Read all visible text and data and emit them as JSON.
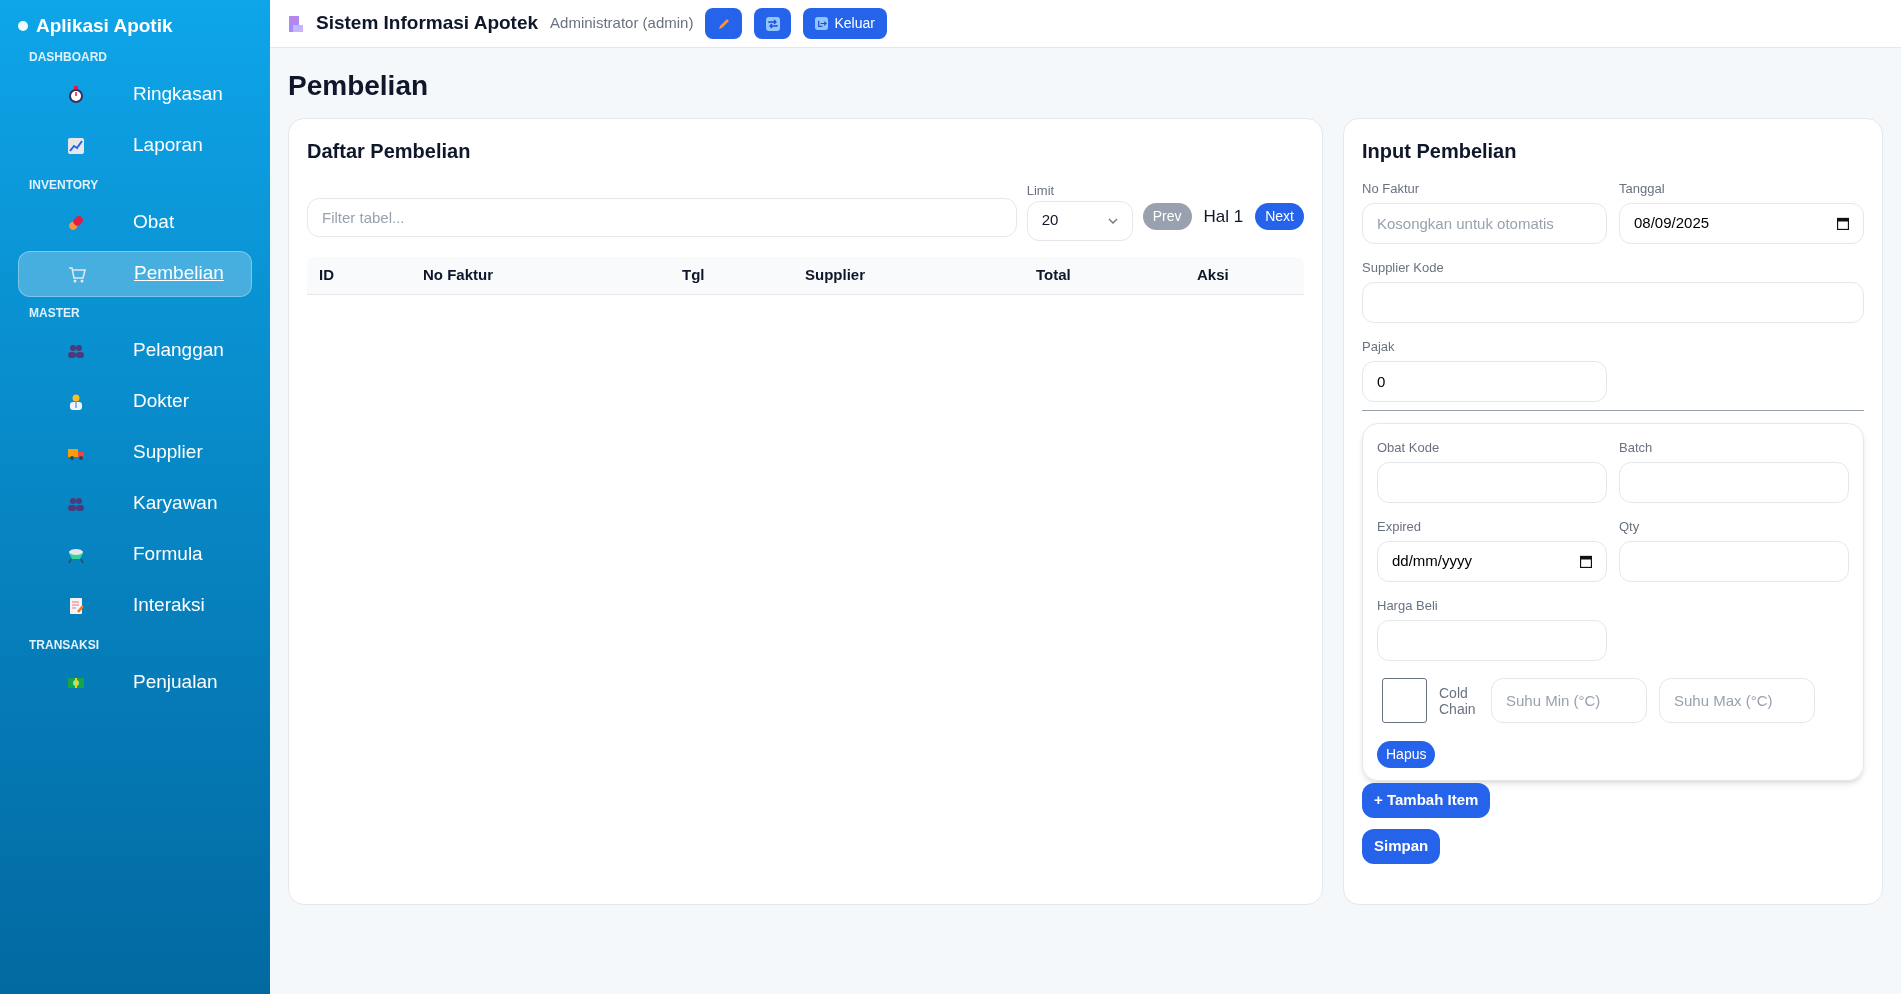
{
  "sidebar": {
    "brand": "Aplikasi Apotik",
    "sections": [
      {
        "title": "DASHBOARD",
        "items": [
          {
            "label": "Ringkasan",
            "selected": false
          },
          {
            "label": "Laporan",
            "selected": false
          }
        ]
      },
      {
        "title": "INVENTORY",
        "items": [
          {
            "label": "Obat",
            "selected": false
          },
          {
            "label": "Pembelian",
            "selected": true
          }
        ]
      },
      {
        "title": "MASTER",
        "items": [
          {
            "label": "Pelanggan",
            "selected": false
          },
          {
            "label": "Dokter",
            "selected": false
          },
          {
            "label": "Supplier",
            "selected": false
          },
          {
            "label": "Karyawan",
            "selected": false
          },
          {
            "label": "Formula",
            "selected": false
          },
          {
            "label": "Interaksi",
            "selected": false
          }
        ]
      },
      {
        "title": "TRANSAKSI",
        "items": [
          {
            "label": "Penjualan",
            "selected": false
          }
        ]
      }
    ]
  },
  "header": {
    "title": "Sistem Informasi Apotek",
    "user": "Administrator (admin)",
    "logout": "Keluar"
  },
  "page_title": "Pembelian",
  "list": {
    "title": "Daftar Pembelian",
    "filter_placeholder": "Filter tabel...",
    "limit_label": "Limit",
    "limit_value": "20",
    "prev": {
      "label": "Prev",
      "disabled": true
    },
    "page": "Hal 1",
    "next": {
      "label": "Next",
      "disabled": false
    },
    "columns": [
      "ID",
      "No Faktur",
      "Tgl",
      "Supplier",
      "Total",
      "Aksi"
    ]
  },
  "form": {
    "title": "Input Pembelian",
    "header_fields": [
      {
        "label": "No Faktur",
        "kind": "text",
        "placeholder": "Kosongkan untuk otomatis"
      },
      {
        "label": "Tanggal",
        "kind": "date",
        "value": "08/09/2025"
      },
      {
        "label": "Supplier Kode",
        "kind": "wide"
      },
      {
        "label": "Pajak",
        "kind": "text",
        "value": "0"
      }
    ],
    "item": {
      "fields": [
        {
          "label": "Obat Kode",
          "kind": "text"
        },
        {
          "label": "Batch",
          "kind": "text"
        },
        {
          "label": "Expired",
          "kind": "date",
          "value": "dd/mm/yyyy"
        },
        {
          "label": "Qty",
          "kind": "text"
        },
        {
          "label": "Harga Beli",
          "kind": "text"
        }
      ],
      "cold_chain": {
        "label": "Cold Chain",
        "checked": false
      },
      "temp_min_placeholder": "Suhu Min (°C)",
      "temp_max_placeholder": "Suhu Max (°C)",
      "remove": "Hapus"
    },
    "add_item": "+ Tambah Item",
    "save": "Simpan"
  }
}
